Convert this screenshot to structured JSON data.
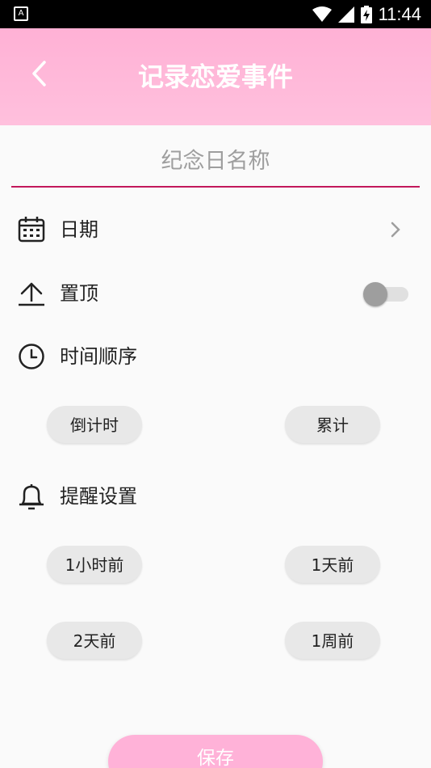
{
  "status_bar": {
    "time": "11:44",
    "left_icon_text": "A",
    "icons": [
      "notification-a-icon",
      "wifi-icon",
      "signal-icon",
      "battery-charging-icon"
    ]
  },
  "header": {
    "title": "记录恋爱事件",
    "back_icon": "back-arrow-icon"
  },
  "name_field": {
    "placeholder": "纪念日名称",
    "value": ""
  },
  "date_row": {
    "label": "日期",
    "icon": "calendar-icon"
  },
  "pin_row": {
    "label": "置顶",
    "icon": "upload-icon",
    "toggle_on": false
  },
  "time_order": {
    "label": "时间顺序",
    "icon": "clock-icon",
    "options": [
      "倒计时",
      "累计"
    ]
  },
  "reminder": {
    "label": "提醒设置",
    "icon": "bell-icon",
    "options": [
      "1小时前",
      "1天前",
      "2天前",
      "1周前"
    ]
  },
  "save_button": {
    "label": "保存"
  },
  "colors": {
    "header_bg": "#ffb1d5",
    "underline": "#c2185b",
    "chip_bg": "#e8e8e8",
    "save_bg": "#ffb2d8"
  }
}
